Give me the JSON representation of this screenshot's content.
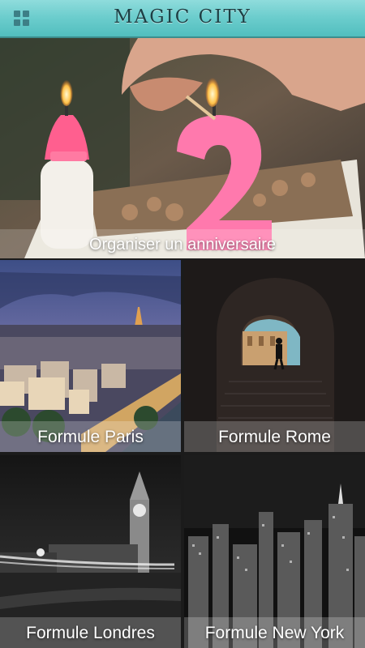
{
  "header": {
    "title": "MAGIC CITY",
    "menu_icon": "grid-menu-icon",
    "accent": "#6ccdcd"
  },
  "tiles": [
    {
      "id": "birthday",
      "label": "Organiser un anniversaire"
    },
    {
      "id": "paris",
      "label": "Formule Paris"
    },
    {
      "id": "rome",
      "label": "Formule Rome"
    },
    {
      "id": "london",
      "label": "Formule Londres"
    },
    {
      "id": "newyork",
      "label": "Formule New York"
    }
  ]
}
